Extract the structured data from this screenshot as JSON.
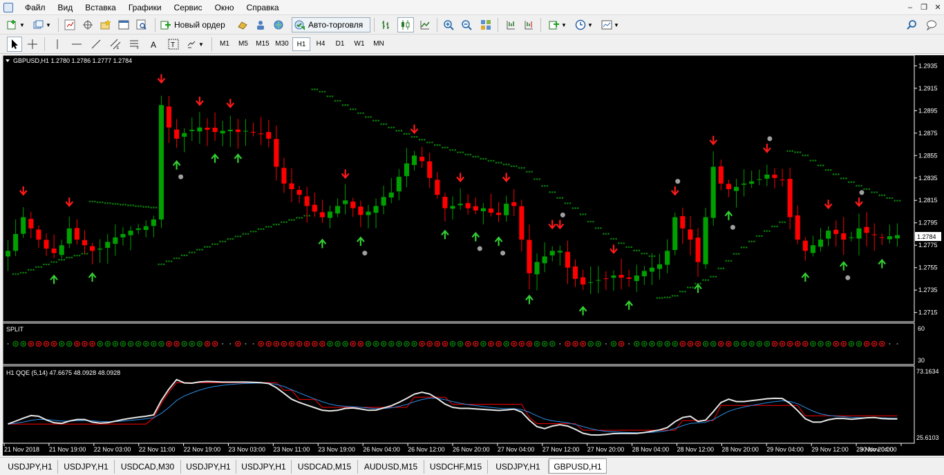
{
  "menubar": {
    "items": [
      "Файл",
      "Вид",
      "Вставка",
      "Графики",
      "Сервис",
      "Окно",
      "Справка"
    ]
  },
  "toolbar": {
    "new_order_label": "Новый ордер",
    "auto_trading_label": "Авто-торговля",
    "timeframes": [
      "M1",
      "M5",
      "M15",
      "M30",
      "H1",
      "H4",
      "D1",
      "W1",
      "MN"
    ],
    "active_timeframe": "H1"
  },
  "chart": {
    "header": "GBPUSD,H1  1.2780 1.2786 1.2777 1.2784",
    "current_price_label": "1.2784",
    "colors": {
      "bull": "#00a000",
      "bear": "#ff0000",
      "psar": "#0b7a0b",
      "arrow_up": "#33cc33",
      "arrow_down": "#ff1a1a",
      "fractal": "#a0a0a0",
      "qqe_fast": "#e8e8e8",
      "qqe_slow": "#2a8fe8",
      "qqe_signal": "#ff0000"
    }
  },
  "chart_data": {
    "type": "candlestick",
    "symbol": "GBPUSD",
    "timeframe": "H1",
    "price_ticks": [
      "1.2935",
      "1.2915",
      "1.2895",
      "1.2875",
      "1.2855",
      "1.2835",
      "1.2815",
      "1.2795",
      "1.2775",
      "1.2755",
      "1.2735",
      "1.2715"
    ],
    "price_range": [
      1.2708,
      1.2942
    ],
    "time_ticks": [
      "21 Nov 2018",
      "21 Nov 19:00",
      "22 Nov 03:00",
      "22 Nov 11:00",
      "22 Nov 19:00",
      "23 Nov 03:00",
      "23 Nov 11:00",
      "23 Nov 19:00",
      "26 Nov 04:00",
      "26 Nov 12:00",
      "26 Nov 20:00",
      "27 Nov 04:00",
      "27 Nov 12:00",
      "27 Nov 20:00",
      "28 Nov 04:00",
      "28 Nov 12:00",
      "28 Nov 20:00",
      "29 Nov 04:00",
      "29 Nov 12:00",
      "29 Nov 20:00",
      "30 Nov 04:00"
    ],
    "closes": [
      1.277,
      1.2785,
      1.28,
      1.279,
      1.278,
      1.2772,
      1.2768,
      1.2775,
      1.279,
      1.278,
      1.2775,
      1.277,
      1.2772,
      1.2778,
      1.2782,
      1.2785,
      1.2788,
      1.279,
      1.2792,
      1.2798,
      1.29,
      1.288,
      1.287,
      1.2875,
      1.2878,
      1.288,
      1.2878,
      1.2876,
      1.2877,
      1.2878,
      1.2876,
      1.2877,
      1.2876,
      1.2874,
      1.287,
      1.2845,
      1.283,
      1.2825,
      1.282,
      1.281,
      1.2805,
      1.28,
      1.2805,
      1.281,
      1.2815,
      1.2808,
      1.2802,
      1.2805,
      1.281,
      1.2818,
      1.2822,
      1.2836,
      1.2848,
      1.2855,
      1.285,
      1.2835,
      1.282,
      1.2808,
      1.281,
      1.2812,
      1.2808,
      1.2806,
      1.2808,
      1.2804,
      1.2802,
      1.2812,
      1.281,
      1.278,
      1.275,
      1.276,
      1.2765,
      1.277,
      1.277,
      1.2755,
      1.2745,
      1.274,
      1.2742,
      1.2744,
      1.2745,
      1.2748,
      1.2746,
      1.2745,
      1.2748,
      1.2752,
      1.2755,
      1.2758,
      1.277,
      1.28,
      1.279,
      1.278,
      1.276,
      1.28,
      1.2845,
      1.283,
      1.2825,
      1.2827,
      1.283,
      1.2832,
      1.2834,
      1.2838,
      1.2835,
      1.2833,
      1.28,
      1.278,
      1.277,
      1.2775,
      1.278,
      1.2788,
      1.2785,
      1.278,
      1.2782,
      1.279,
      1.2786,
      1.2784,
      1.2782,
      1.2783,
      1.2784
    ],
    "qqe_label": "H1  QQE (5,14) 47.6675 48.0928 48.0928",
    "qqe_range": [
      25.6103,
      73.1634
    ],
    "qqe_ticks": [
      "73.1634",
      "25.6103"
    ],
    "split_label": "SPLIT",
    "split_ticks": [
      "60",
      "30"
    ]
  },
  "tabs": [
    "USDJPY,H1",
    "USDJPY,H1",
    "USDCAD,M30",
    "USDJPY,H1",
    "USDJPY,H1",
    "USDCAD,M15",
    "AUDUSD,M15",
    "USDCHF,M15",
    "USDJPY,H1",
    "GBPUSD,H1"
  ],
  "active_tab": "GBPUSD,H1"
}
